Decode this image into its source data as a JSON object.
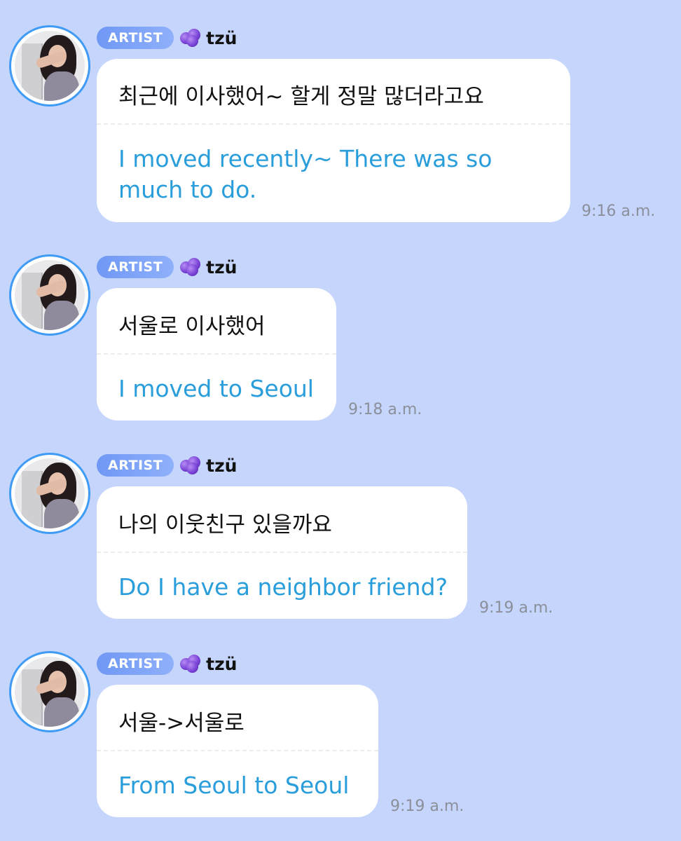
{
  "messages": [
    {
      "badge": "ARTIST",
      "name": "tzü",
      "original": "최근에 이사했어~ 할게 정말 많더라고요",
      "translation": "I moved recently~ There was so much to do.",
      "time": "9:16 a.m."
    },
    {
      "badge": "ARTIST",
      "name": "tzü",
      "original": "서울로 이사했어",
      "translation": "I moved to Seoul",
      "time": "9:18 a.m."
    },
    {
      "badge": "ARTIST",
      "name": "tzü",
      "original": "나의 이웃친구 있을까요",
      "translation": "Do I have a neighbor friend?",
      "time": "9:19 a.m."
    },
    {
      "badge": "ARTIST",
      "name": "tzü",
      "original": "서울->서울로",
      "translation": "From Seoul to Seoul",
      "time": "9:19 a.m."
    }
  ],
  "icons": {
    "avatar": "avatar-photo",
    "name_emoji": "grape-icon"
  },
  "colors": {
    "background": "#c5d5fc",
    "badge": "#7aa0f7",
    "translation_text": "#2a9ddb",
    "avatar_ring": "#3f9bf5"
  }
}
